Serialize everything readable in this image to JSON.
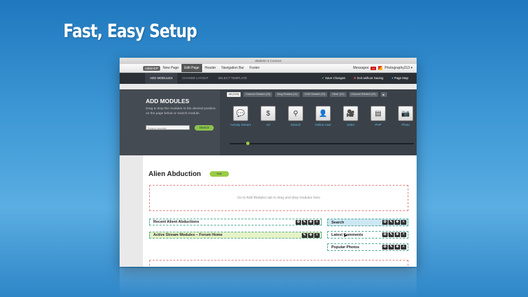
{
  "headline": "Fast, Easy Setup",
  "window": {
    "title": "vBulletin 5 Connect",
    "topnav": {
      "admincp": "AdminCP",
      "items": [
        "New Page",
        "Edit Page",
        "Header",
        "Navigation Bar",
        "Footer"
      ],
      "active_index": 1,
      "messages_label": "Messages",
      "messages_count": "11",
      "user": "Photography213 ▾"
    },
    "toolbar": {
      "tabs": [
        "ADD MODULES",
        "CHANGE LAYOUT",
        "SELECT TEMPLATE"
      ],
      "save": "Save Changes",
      "exit": "Exit without Saving",
      "pagemap": "Page Map"
    },
    "add_modules": {
      "title": "ADD MODULES",
      "description": "Drag & drop the modules to the desired position on the page below or search module.",
      "search_placeholder": "Search module",
      "search_button": "Search",
      "filters": [
        "All (120)",
        "Channel Related (33)",
        "Blog Related (15)",
        "CMS Related (33)",
        "Other (31)",
        "Channel Related (33)"
      ],
      "modules": [
        {
          "label": "Activity Stream",
          "icon": "speech-bubbles-icon"
        },
        {
          "label": "Ad",
          "icon": "money-bag-icon"
        },
        {
          "label": "Search",
          "icon": "magnifier-icon"
        },
        {
          "label": "Online User",
          "icon": "user-icon"
        },
        {
          "label": "Video",
          "icon": "video-camera-icon"
        },
        {
          "label": "PHP",
          "icon": "php-file-icon"
        },
        {
          "label": "Photo",
          "icon": "camera-icon"
        }
      ]
    },
    "page": {
      "title": "Alien Abduction",
      "edit": "Edit",
      "dropzone_text": "Go to Add Modules tab to drag and drop modules here",
      "left_modules": [
        "Recent Alient Abductions",
        "Active Stream Modules – Forum Home"
      ],
      "right_modules": [
        "Search",
        "Latest Comments",
        "Popular Photos"
      ]
    }
  }
}
